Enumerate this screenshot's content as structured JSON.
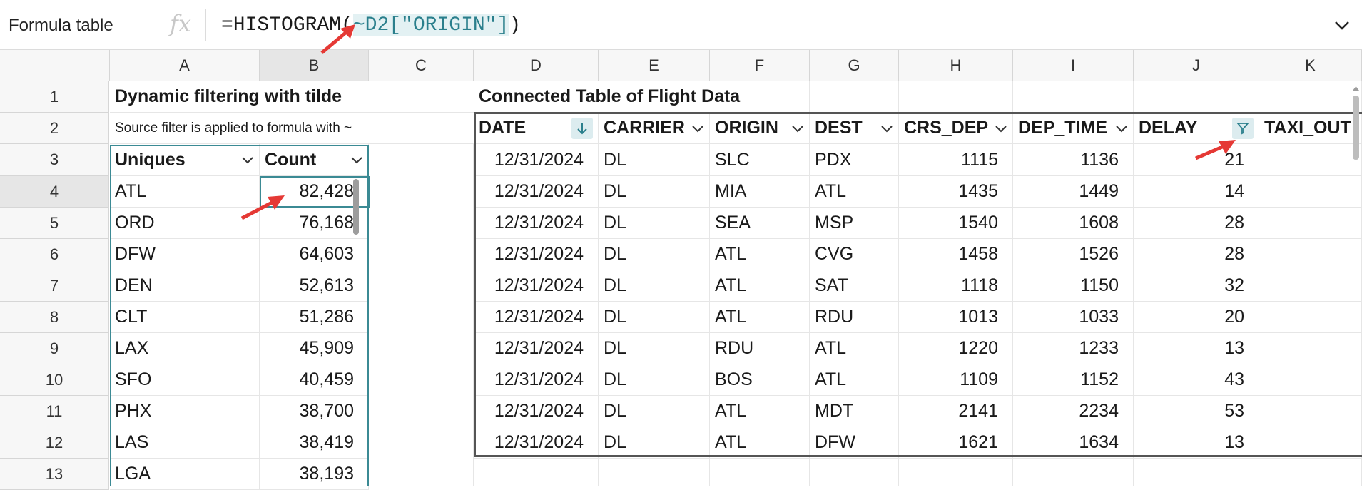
{
  "formula_bar": {
    "name_box": "Formula table",
    "fx_label": "fx",
    "formula_prefix": "=HISTOGRAM(",
    "formula_ref": "~D2[\"ORIGIN\"]",
    "formula_suffix": ")"
  },
  "columns": [
    "A",
    "B",
    "C",
    "D",
    "E",
    "F",
    "G",
    "H",
    "I",
    "J",
    "K"
  ],
  "rows": [
    "1",
    "2",
    "3",
    "4",
    "5",
    "6",
    "7",
    "8",
    "9",
    "10",
    "11",
    "12",
    "13"
  ],
  "cells": {
    "a1_title": "Dynamic filtering with tilde",
    "a2_note": "Source filter is applied to formula with ~",
    "d1_title": "Connected Table of Flight Data"
  },
  "histogram_table": {
    "headers": [
      "Uniques",
      "Count"
    ],
    "rows": [
      [
        "ATL",
        "82,428"
      ],
      [
        "ORD",
        "76,168"
      ],
      [
        "DFW",
        "64,603"
      ],
      [
        "DEN",
        "52,613"
      ],
      [
        "CLT",
        "51,286"
      ],
      [
        "LAX",
        "45,909"
      ],
      [
        "SFO",
        "40,459"
      ],
      [
        "PHX",
        "38,700"
      ],
      [
        "LAS",
        "38,419"
      ],
      [
        "LGA",
        "38,193"
      ]
    ]
  },
  "flight_table": {
    "headers": [
      "DATE",
      "CARRIER",
      "ORIGIN",
      "DEST",
      "CRS_DEP",
      "DEP_TIME",
      "DELAY",
      "TAXI_OUT"
    ],
    "rows": [
      [
        "12/31/2024",
        "DL",
        "SLC",
        "PDX",
        "1115",
        "1136",
        "21"
      ],
      [
        "12/31/2024",
        "DL",
        "MIA",
        "ATL",
        "1435",
        "1449",
        "14"
      ],
      [
        "12/31/2024",
        "DL",
        "SEA",
        "MSP",
        "1540",
        "1608",
        "28"
      ],
      [
        "12/31/2024",
        "DL",
        "ATL",
        "CVG",
        "1458",
        "1526",
        "28"
      ],
      [
        "12/31/2024",
        "DL",
        "ATL",
        "SAT",
        "1118",
        "1150",
        "32"
      ],
      [
        "12/31/2024",
        "DL",
        "ATL",
        "RDU",
        "1013",
        "1033",
        "20"
      ],
      [
        "12/31/2024",
        "DL",
        "RDU",
        "ATL",
        "1220",
        "1233",
        "13"
      ],
      [
        "12/31/2024",
        "DL",
        "BOS",
        "ATL",
        "1109",
        "1152",
        "43"
      ],
      [
        "12/31/2024",
        "DL",
        "ATL",
        "MDT",
        "2141",
        "2234",
        "53"
      ],
      [
        "12/31/2024",
        "DL",
        "ATL",
        "DFW",
        "1621",
        "1634",
        "13"
      ]
    ]
  },
  "colors": {
    "accent": "#3b8a94",
    "annotation_arrow": "#e53935",
    "header_bg": "#f7f7f7",
    "ref_highlight": "#e3f1f3"
  }
}
